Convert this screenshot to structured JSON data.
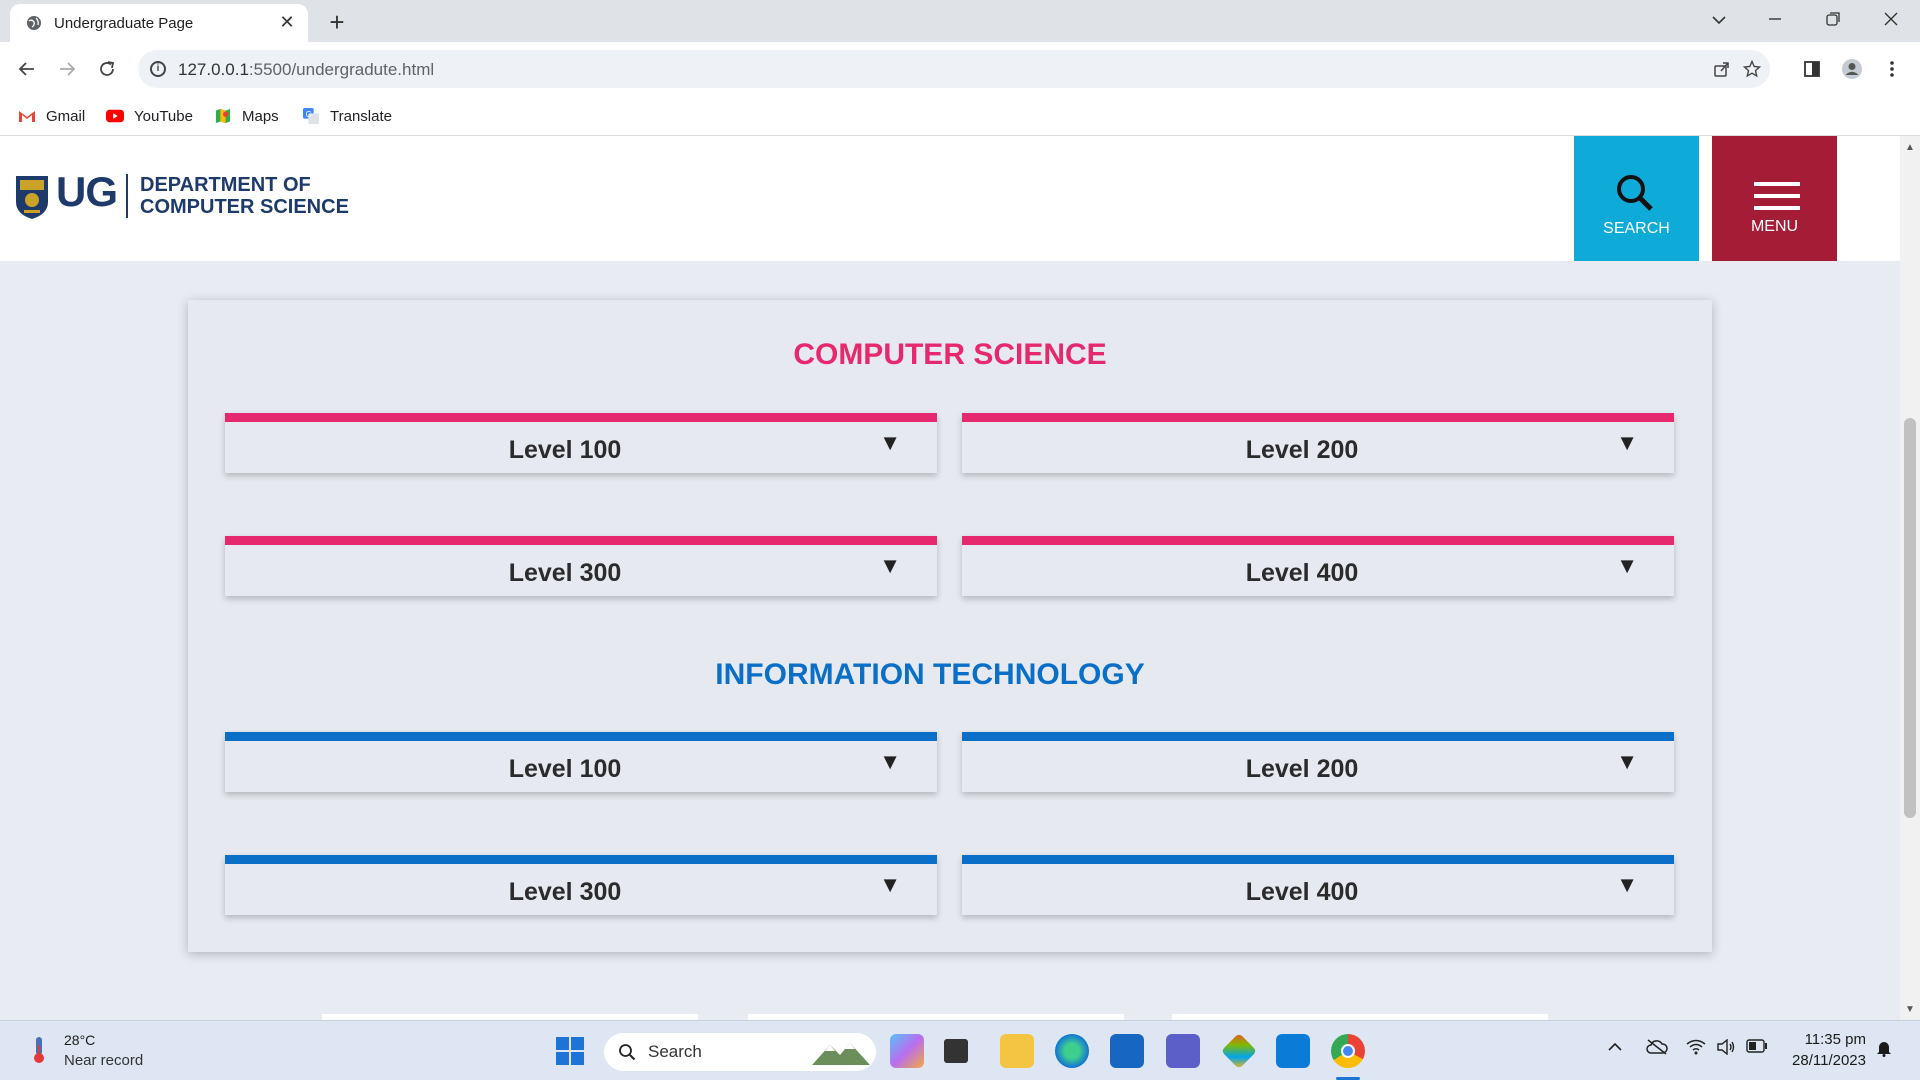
{
  "browser": {
    "tab_title": "Undergraduate Page",
    "tab_close": "✕",
    "new_tab": "+",
    "url_host": "127.0.0.1",
    "url_path": ":5500/undergradute.html",
    "bookmarks": [
      {
        "label": "Gmail"
      },
      {
        "label": "YouTube"
      },
      {
        "label": "Maps"
      },
      {
        "label": "Translate"
      }
    ]
  },
  "header": {
    "logo_abbr": "UG",
    "dept_line1": "DEPARTMENT OF",
    "dept_line2": "COMPUTER SCIENCE",
    "search_label": "SEARCH",
    "menu_label": "MENU"
  },
  "sections": [
    {
      "title": "COMPUTER SCIENCE",
      "color": "#e6296f",
      "levels": [
        "Level 100",
        "Level 200",
        "Level 300",
        "Level 400"
      ]
    },
    {
      "title": "INFORMATION TECHNOLOGY",
      "color": "#0b6fc7",
      "levels": [
        "Level 100",
        "Level 200",
        "Level 300",
        "Level 400"
      ]
    }
  ],
  "dropdown_arrow": "▼",
  "taskbar": {
    "temperature": "28°C",
    "weather_note": "Near record",
    "search_label": "Search",
    "time": "11:35 pm",
    "date": "28/11/2023"
  }
}
